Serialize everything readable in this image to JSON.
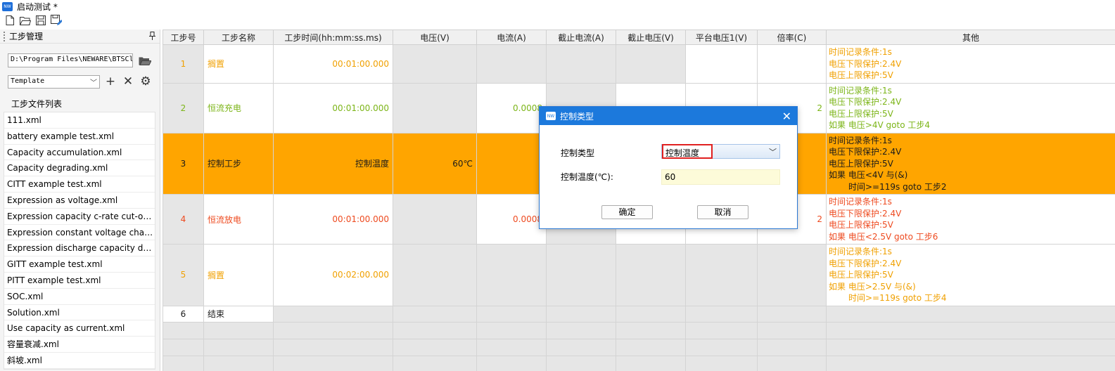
{
  "window": {
    "title": "启动测试 *",
    "logo_text": "NW"
  },
  "left_panel": {
    "title": "工步管理",
    "pin_icon": "pin-icon",
    "path": "D:\\Program Files\\NEWARE\\BTSCl",
    "template": "Template",
    "files_label": "工步文件列表",
    "files": [
      "111.xml",
      "battery example test.xml",
      "Capacity accumulation.xml",
      "Capacity degrading.xml",
      "CITT example test.xml",
      "Expression as voltage.xml",
      "Expression capacity c-rate cut-off....",
      "Expression constant voltage charg...",
      "Expression discharge capacity del...",
      "GITT example test.xml",
      "PITT example test.xml",
      "SOC.xml",
      "Solution.xml",
      "Use capacity as current.xml",
      "容量衰减.xml",
      "斜坡.xml"
    ]
  },
  "grid": {
    "headers": [
      "工步号",
      "工步名称",
      "工步时间(hh:mm:ss.ms)",
      "电压(V)",
      "电流(A)",
      "截止电流(A)",
      "截止电压(V)",
      "平台电压1(V)",
      "倍率(C)",
      "其他"
    ],
    "rows": [
      {
        "no": "1",
        "name": "搁置",
        "time": "00:01:00.000",
        "voltage": "",
        "current": "",
        "rate": "",
        "other": [
          "时间记录条件:1s",
          "电压下限保护:2.4V",
          "电压上限保护:5V"
        ]
      },
      {
        "no": "2",
        "name": "恒流充电",
        "time": "00:01:00.000",
        "voltage": "",
        "current": "0.0008",
        "rate": "2",
        "other": [
          "时间记录条件:1s",
          "电压下限保护:2.4V",
          "电压上限保护:5V",
          "如果 电压>4V goto 工步4"
        ]
      },
      {
        "no": "3",
        "name": "控制工步",
        "time": "控制温度",
        "voltage": "60℃",
        "current": "",
        "rate": "",
        "other": [
          "时间记录条件:1s",
          "电压下限保护:2.4V",
          "电压上限保护:5V",
          "如果 电压<4V 与(&)",
          "时间>=119s goto 工步2"
        ]
      },
      {
        "no": "4",
        "name": "恒流放电",
        "time": "00:01:00.000",
        "voltage": "",
        "current": "0.0008",
        "rate": "2",
        "other": [
          "时间记录条件:1s",
          "电压下限保护:2.4V",
          "电压上限保护:5V",
          "如果 电压<2.5V goto 工步6"
        ]
      },
      {
        "no": "5",
        "name": "搁置",
        "time": "00:02:00.000",
        "voltage": "",
        "current": "",
        "rate": "",
        "other": [
          "时间记录条件:1s",
          "电压下限保护:2.4V",
          "电压上限保护:5V",
          "如果 电压>2.5V 与(&)",
          "时间>=119s goto 工步4"
        ]
      },
      {
        "no": "6",
        "name": "结束",
        "time": "",
        "voltage": "",
        "current": "",
        "rate": "",
        "other": []
      }
    ]
  },
  "dialog": {
    "title": "控制类型",
    "type_label": "控制类型",
    "type_value": "控制温度",
    "temp_label": "控制温度(℃):",
    "temp_value": "60",
    "ok_label": "确定",
    "cancel_label": "取消"
  },
  "colors": {
    "selected_row": "#ffa500",
    "dialog_title": "#1c79dc",
    "rest": "#f0a000",
    "charge": "#7cb518",
    "discharge": "#ee4a1f"
  }
}
